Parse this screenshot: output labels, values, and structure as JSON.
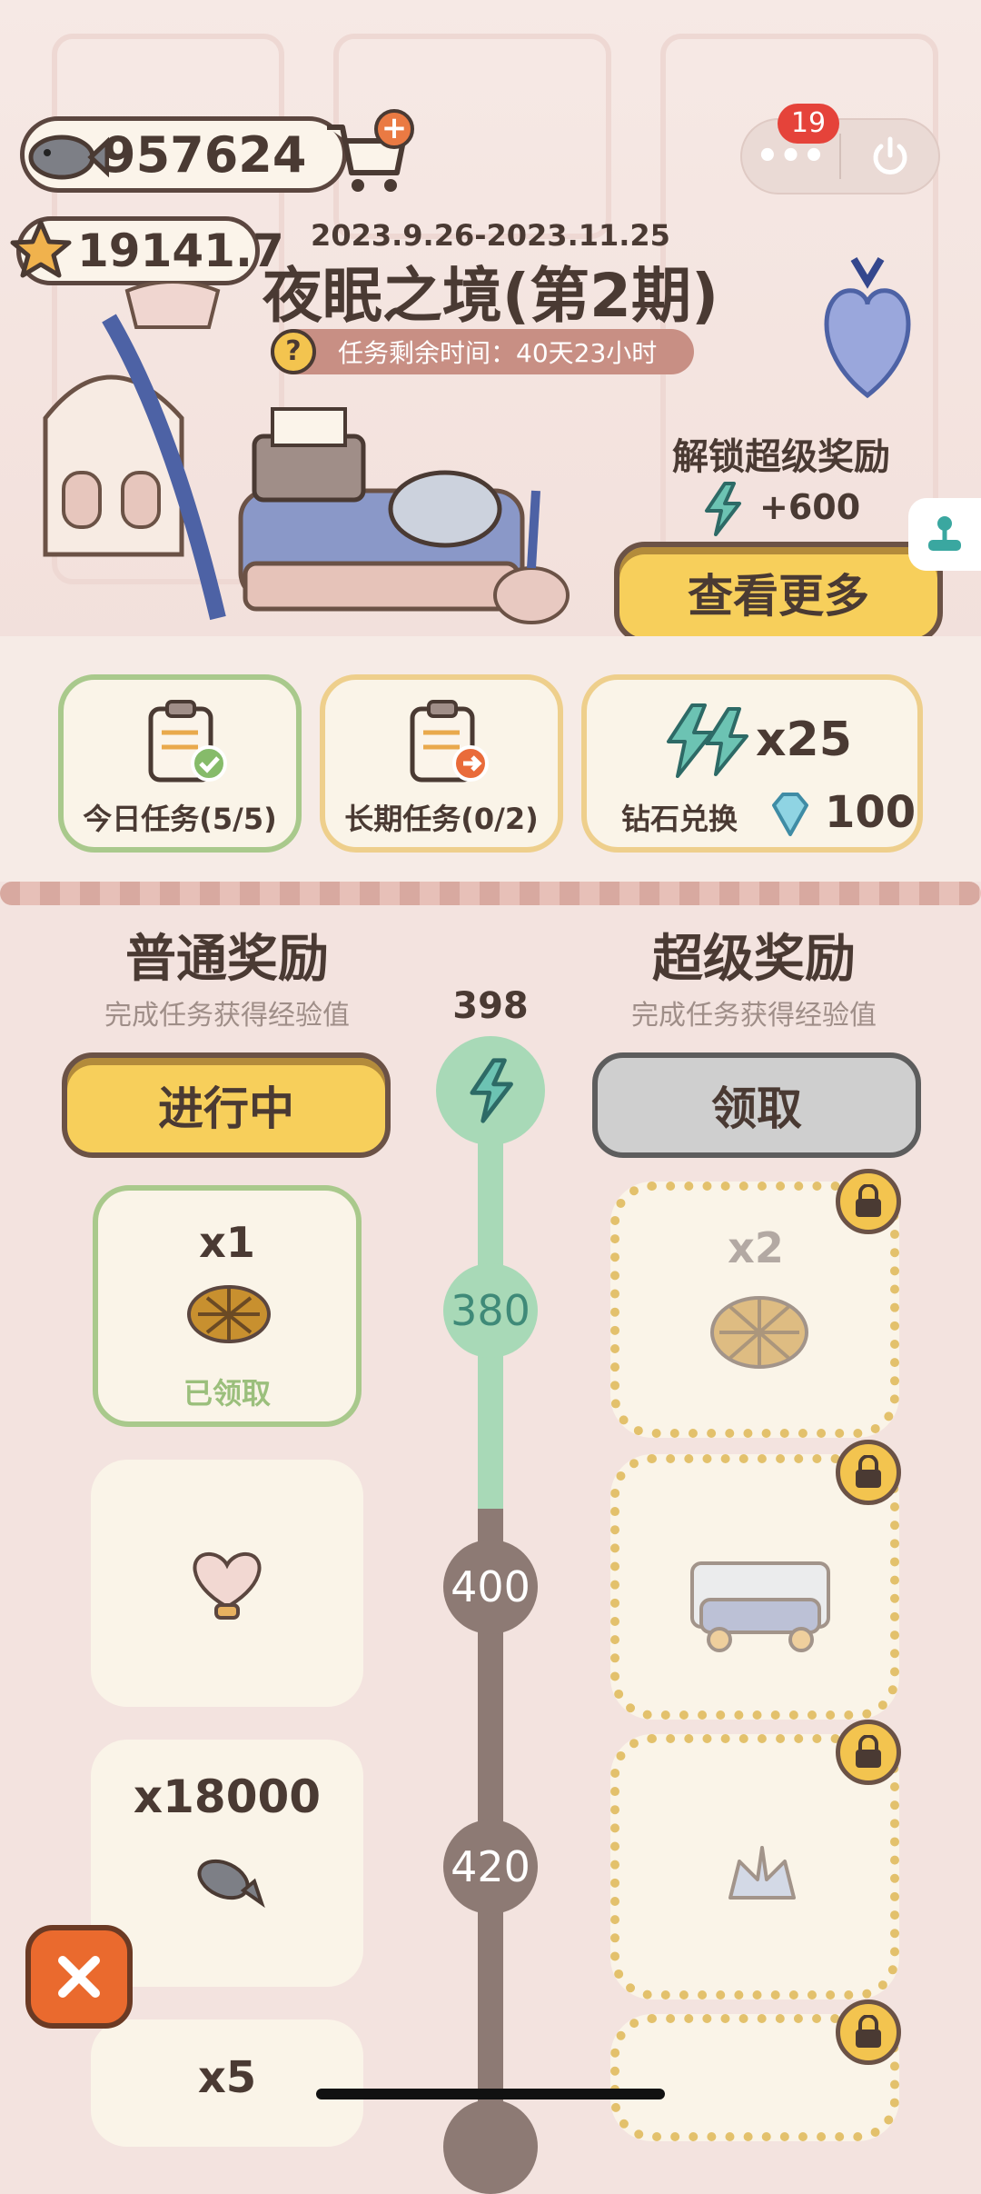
{
  "currency": {
    "fish": "957624",
    "star": "19141.7"
  },
  "event": {
    "dates": "2023.9.26-2023.11.25",
    "title": "夜眠之境(第2期)",
    "remaining": "任务剩余时间：40天23小时"
  },
  "header": {
    "badge_count": "19"
  },
  "super_unlock": {
    "label": "解锁超级奖励",
    "bonus": "+600",
    "button": "查看更多"
  },
  "tasks": {
    "daily": "今日任务(5/5)",
    "long": "长期任务(0/2)",
    "exchange_label": "钻石兑换",
    "exchange_qty": "x25",
    "exchange_cost": "100"
  },
  "rewards": {
    "normal_title": "普通奖励",
    "normal_sub": "完成任务获得经验值",
    "super_title": "超级奖励",
    "super_sub": "完成任务获得经验值",
    "current_exp": "398",
    "normal_button": "进行中",
    "super_button": "领取",
    "levels": [
      "380",
      "400",
      "420"
    ],
    "normal_items": [
      {
        "qty": "x1",
        "status": "已领取"
      },
      {
        "qty": ""
      },
      {
        "qty": "x18000"
      },
      {
        "qty": "x5"
      }
    ],
    "super_items": [
      {
        "qty": "x2"
      }
    ]
  },
  "colors": {
    "accent_yellow": "#f7cf5b",
    "progress_green": "#a8d9b7",
    "track_gray": "#8d7a74",
    "close_orange": "#ea6a2e"
  }
}
